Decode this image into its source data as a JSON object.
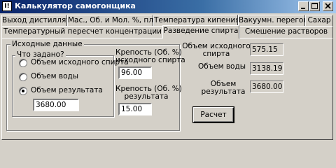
{
  "window": {
    "title": "Калькулятор самогонщика",
    "icon_glyph": "I!"
  },
  "tabs_row_top": [
    "Выход дистиллята",
    "Мас., Об. и Мол. %, плотн.",
    "Температура кипения и пар",
    "Вакуумн. перегонка",
    "Сахар"
  ],
  "tabs_row_bottom": [
    "Температурный пересчет концентрации",
    "Разведение спирта",
    "Смешение растворов"
  ],
  "active_tab": "Разведение спирта",
  "source_group": {
    "title": "Исходные данные",
    "what_given": {
      "title": "Что задано?",
      "options": [
        "Объем исходного спирта",
        "Объем воды",
        "Объем результата"
      ],
      "selected": "Объем результата",
      "value": "3680.00"
    },
    "strength_source": {
      "label_line1": "Крепость (Об. %)",
      "label_line2": "исходного спирта",
      "value": "96.00"
    },
    "strength_result": {
      "label_line1": "Крепость (Об. %)",
      "label_line2": "результата",
      "value": "15.00"
    }
  },
  "results": {
    "source_volume": {
      "label_line1": "Объем исходного",
      "label_line2": "спирта",
      "value": "575.15"
    },
    "water_volume": {
      "label": "Объем воды",
      "value": "3138.19"
    },
    "result_volume": {
      "label_line1": "Объем",
      "label_line2": "результата",
      "value": "3680.00"
    }
  },
  "calc_button": "Расчет",
  "icons": {
    "app": "app-icon",
    "minimize": "minimize-icon",
    "maximize": "maximize-icon",
    "close": "close-icon"
  }
}
